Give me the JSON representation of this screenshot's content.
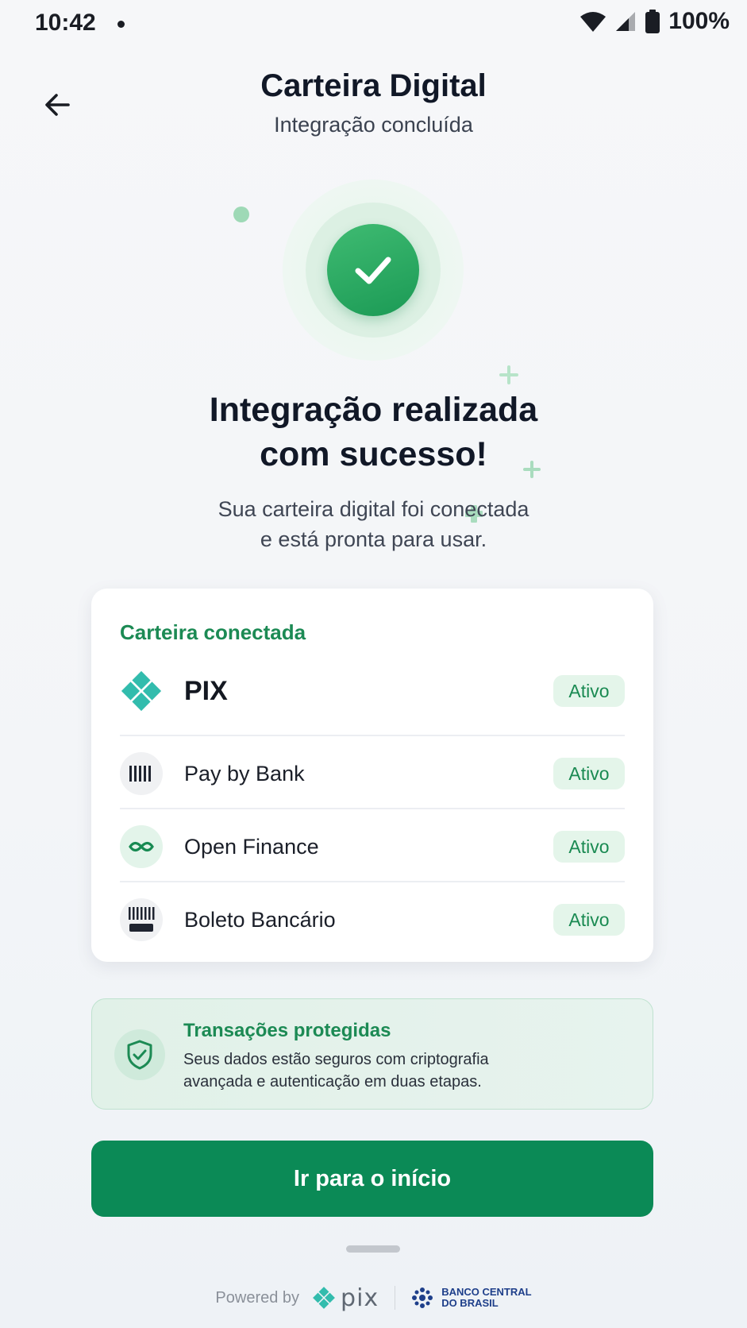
{
  "status_bar": {
    "time": "10:42",
    "battery": "100%"
  },
  "header": {
    "title": "Carteira Digital",
    "subtitle": "Integração concluída"
  },
  "success": {
    "title_line1": "Integração realizada",
    "title_line2": "com sucesso!",
    "desc_line1": "Sua carteira digital foi conectada",
    "desc_line2": "e está pronta para usar."
  },
  "wallet": {
    "heading": "Carteira conectada",
    "items": [
      {
        "label": "PIX",
        "status": "Ativo",
        "icon": "pix-icon"
      },
      {
        "label": "Pay by Bank",
        "status": "Ativo",
        "icon": "barcode-icon"
      },
      {
        "label": "Open Finance",
        "status": "Ativo",
        "icon": "open-finance-icon"
      },
      {
        "label": "Boleto Bancário",
        "status": "Ativo",
        "icon": "boleto-icon"
      }
    ]
  },
  "security": {
    "title": "Transações protegidas",
    "line1": "Seus dados estão seguros com criptografia",
    "line2": "avançada e autenticação em duas etapas."
  },
  "cta": {
    "label": "Ir para o início"
  },
  "footer": {
    "powered_by": "Powered by",
    "pix_brand": "pix",
    "bcb_line1": "BANCO CENTRAL",
    "bcb_line2": "DO BRASIL"
  },
  "colors": {
    "accent": "#0b8a56",
    "success_green": "#1b9a55",
    "badge_bg": "#e4f5ea",
    "text_dark": "#111827"
  }
}
